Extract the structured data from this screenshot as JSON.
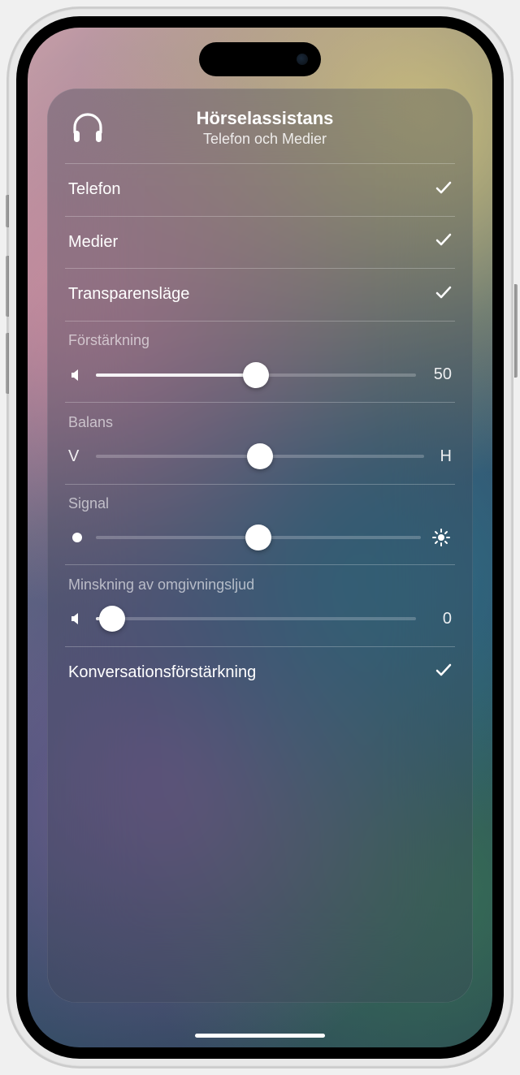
{
  "header": {
    "title": "Hörselassistans",
    "subtitle": "Telefon och Medier"
  },
  "options": {
    "phone": {
      "label": "Telefon",
      "checked": true
    },
    "media": {
      "label": "Medier",
      "checked": true
    },
    "transparency": {
      "label": "Transparensläge",
      "checked": true
    },
    "conversation_boost": {
      "label": "Konversationsförstärkning",
      "checked": true
    }
  },
  "sliders": {
    "amplification": {
      "label": "Förstärkning",
      "value": "50",
      "position": 50
    },
    "balance": {
      "label": "Balans",
      "left": "V",
      "right": "H",
      "position": 50
    },
    "tone": {
      "label": "Signal",
      "position": 50
    },
    "ambient_noise": {
      "label": "Minskning av omgivningsljud",
      "value": "0",
      "position": 5
    }
  }
}
